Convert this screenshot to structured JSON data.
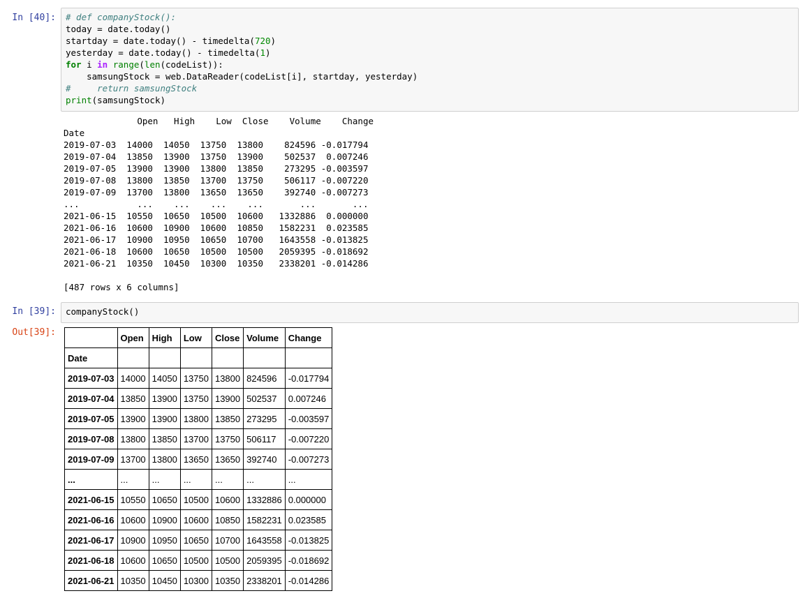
{
  "cell_40": {
    "prompt": "In [40]:",
    "code": {
      "line1": "# def companyStock():",
      "line2": "today = date.today()",
      "line3_a": "startday = date.today() - timedelta(",
      "line3_num": "720",
      "line3_b": ")",
      "line4_a": "yesterday = date.today() - timedelta(",
      "line4_num": "1",
      "line4_b": ")",
      "line5_for": "for",
      "line5_a": " i ",
      "line5_in": "in",
      "line5_sp": " ",
      "line5_range": "range",
      "line5_paren": "(",
      "line5_len": "len",
      "line5_b": "(codeList)):",
      "line6": "    samsungStock = web.DataReader(codeList[i], startday, yesterday)",
      "line7": "#     return samsungStock",
      "line8_print": "print",
      "line8_b": "(samsungStock)"
    },
    "output_lines": [
      "              Open   High    Low  Close    Volume    Change",
      "Date",
      "2019-07-03  14000  14050  13750  13800    824596 -0.017794",
      "2019-07-04  13850  13900  13750  13900    502537  0.007246",
      "2019-07-05  13900  13900  13800  13850    273295 -0.003597",
      "2019-07-08  13800  13850  13700  13750    506117 -0.007220",
      "2019-07-09  13700  13800  13650  13650    392740 -0.007273",
      "...           ...    ...    ...    ...       ...       ...",
      "2021-06-15  10550  10650  10500  10600   1332886  0.000000",
      "2021-06-16  10600  10900  10600  10850   1582231  0.023585",
      "2021-06-17  10900  10950  10650  10700   1643558 -0.013825",
      "2021-06-18  10600  10650  10500  10500   2059395 -0.018692",
      "2021-06-21  10350  10450  10300  10350   2338201 -0.014286",
      "",
      "[487 rows x 6 columns]"
    ]
  },
  "cell_39": {
    "prompt": "In [39]:",
    "code": "companyStock()",
    "out_prompt": "Out[39]:",
    "table": {
      "columns": [
        "",
        "Open",
        "High",
        "Low",
        "Close",
        "Volume",
        "Change"
      ],
      "index_name": "Date",
      "rows": [
        [
          "2019-07-03",
          "14000",
          "14050",
          "13750",
          "13800",
          "824596",
          "-0.017794"
        ],
        [
          "2019-07-04",
          "13850",
          "13900",
          "13750",
          "13900",
          "502537",
          "0.007246"
        ],
        [
          "2019-07-05",
          "13900",
          "13900",
          "13800",
          "13850",
          "273295",
          "-0.003597"
        ],
        [
          "2019-07-08",
          "13800",
          "13850",
          "13700",
          "13750",
          "506117",
          "-0.007220"
        ],
        [
          "2019-07-09",
          "13700",
          "13800",
          "13650",
          "13650",
          "392740",
          "-0.007273"
        ],
        [
          "...",
          "...",
          "...",
          "...",
          "...",
          "...",
          "..."
        ],
        [
          "2021-06-15",
          "10550",
          "10650",
          "10500",
          "10600",
          "1332886",
          "0.000000"
        ],
        [
          "2021-06-16",
          "10600",
          "10900",
          "10600",
          "10850",
          "1582231",
          "0.023585"
        ],
        [
          "2021-06-17",
          "10900",
          "10950",
          "10650",
          "10700",
          "1643558",
          "-0.013825"
        ],
        [
          "2021-06-18",
          "10600",
          "10650",
          "10500",
          "10500",
          "2059395",
          "-0.018692"
        ],
        [
          "2021-06-21",
          "10350",
          "10450",
          "10300",
          "10350",
          "2338201",
          "-0.014286"
        ]
      ]
    }
  }
}
